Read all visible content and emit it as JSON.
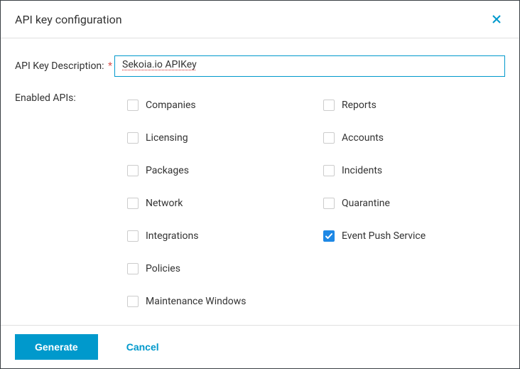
{
  "header": {
    "title": "API key configuration"
  },
  "form": {
    "description_label": "API Key Description:",
    "description_required": "*",
    "description_value": "Sekoia.io APIKey",
    "enabled_apis_label": "Enabled APIs:"
  },
  "apis": {
    "left": [
      {
        "label": "Companies",
        "checked": false
      },
      {
        "label": "Licensing",
        "checked": false
      },
      {
        "label": "Packages",
        "checked": false
      },
      {
        "label": "Network",
        "checked": false
      },
      {
        "label": "Integrations",
        "checked": false
      },
      {
        "label": "Policies",
        "checked": false
      },
      {
        "label": "Maintenance Windows",
        "checked": false
      }
    ],
    "right": [
      {
        "label": "Reports",
        "checked": false
      },
      {
        "label": "Accounts",
        "checked": false
      },
      {
        "label": "Incidents",
        "checked": false
      },
      {
        "label": "Quarantine",
        "checked": false
      },
      {
        "label": "Event Push Service",
        "checked": true
      }
    ]
  },
  "footer": {
    "generate_label": "Generate",
    "cancel_label": "Cancel"
  }
}
